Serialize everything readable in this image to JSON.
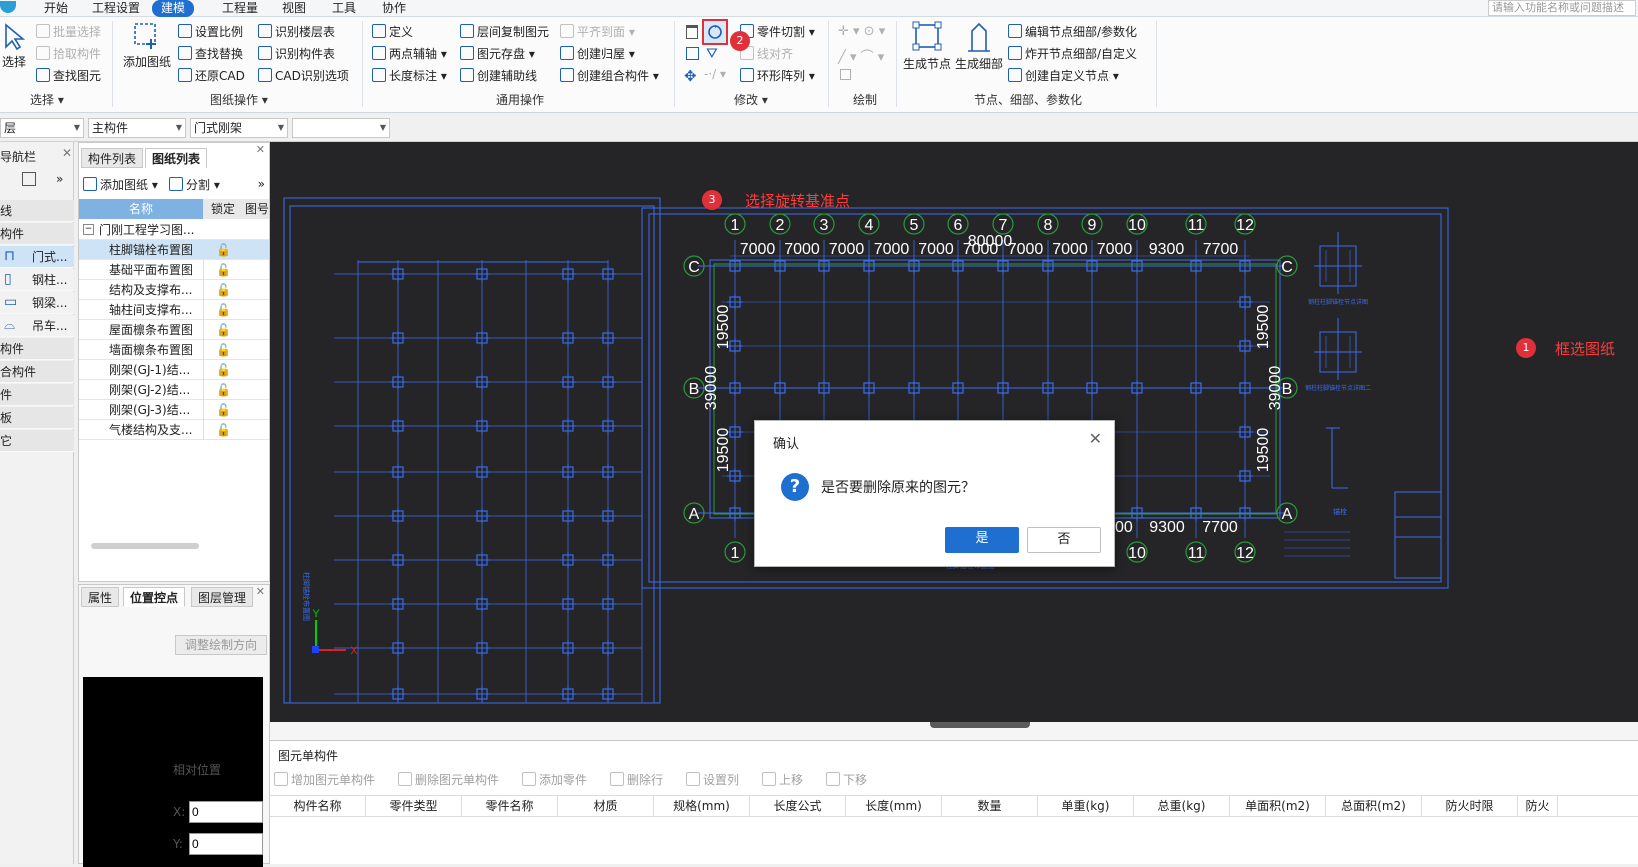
{
  "menubar": {
    "items": [
      "开始",
      "工程设置",
      "建模",
      "工程量",
      "视图",
      "工具",
      "协作"
    ],
    "active_index": 2,
    "search_placeholder": "请输入功能名称或问题描述"
  },
  "ribbon": {
    "select": {
      "big_label": "选择",
      "items": [
        "批量选择",
        "拾取构件",
        "查找图元"
      ],
      "group_label": "选择"
    },
    "drawing_ops": {
      "big_label": "添加图纸",
      "items": [
        "设置比例",
        "查找替换",
        "还原CAD",
        "识别楼层表",
        "识别构件表",
        "CAD识别选项"
      ],
      "group_label": "图纸操作"
    },
    "general_ops": {
      "items": [
        "定义",
        "两点辅轴",
        "长度标注",
        "层间复制图元",
        "图元存盘",
        "创建辅助线",
        "平齐到面",
        "创建归屋",
        "创建组合构件"
      ],
      "group_label": "通用操作"
    },
    "modify": {
      "items": [
        "零件切割",
        "线对齐",
        "环形阵列"
      ],
      "group_label": "修改"
    },
    "draw": {
      "group_label": "绘制"
    },
    "nodes": {
      "big_items": [
        "生成节点",
        "生成细部"
      ],
      "items": [
        "编辑节点细部/参数化",
        "炸开节点细部/自定义",
        "创建自定义节点"
      ],
      "group_label": "节点、细部、参数化"
    }
  },
  "selectors": {
    "floor": "层",
    "category": "主构件",
    "type": "门式刚架",
    "blank": ""
  },
  "nav": {
    "title": "导航栏",
    "rows": [
      "线",
      "构件",
      "门式...",
      "钢柱...",
      "钢梁...",
      "吊车...",
      "构件",
      "合构件",
      "件",
      "板",
      "它"
    ]
  },
  "drawing_panel": {
    "tabs": [
      "构件列表",
      "图纸列表"
    ],
    "toolbar": [
      "添加图纸",
      "分割"
    ],
    "headers": [
      "名称",
      "锁定",
      "图号"
    ],
    "root": "门刚工程学习图...",
    "rows": [
      "柱脚锚栓布置图",
      "基础平面布置图",
      "结构及支撑布...",
      "轴柱间支撑布...",
      "屋面檩条布置图",
      "墙面檩条布置图",
      "刚架(GJ-1)结...",
      "刚架(GJ-2)结...",
      "刚架(GJ-3)结...",
      "气楼结构及支..."
    ],
    "selected_index": 0
  },
  "prop_panel": {
    "tabs": [
      "属性",
      "位置控点",
      "图层管理"
    ],
    "active_tab": 1,
    "adjust_button": "调整绘制方向",
    "relative_label": "相对位置",
    "x_label": "X:",
    "x_value": "0",
    "y_label": "Y:",
    "y_value": "0"
  },
  "canvas": {
    "axes_top": [
      "1",
      "2",
      "3",
      "4",
      "5",
      "6",
      "7",
      "8",
      "9",
      "10",
      "11",
      "12"
    ],
    "spans": [
      "7000",
      "7000",
      "7000",
      "7000",
      "7000",
      "7000",
      "7000",
      "7000",
      "7000",
      "9300",
      "7700"
    ],
    "total": "80000",
    "rows": [
      "C",
      "B",
      "A"
    ],
    "side_dims": [
      "19500",
      "19500"
    ],
    "side_total": "39000",
    "bottom_partial": [
      "00",
      "7000",
      "9300",
      "7700"
    ],
    "tiny_text": {
      "left_plan_caption": "柱脚锚栓布置图",
      "right_caption": "柱脚锚栓布置图",
      "detail_a": "钢柱柱脚锚栓节点详图",
      "detail_b": "钢柱柱脚锚栓节点详图二",
      "detail_c": "锚栓"
    },
    "annotations": [
      {
        "num": "1",
        "text": "框选图纸"
      },
      {
        "num": "2",
        "text": ""
      },
      {
        "num": "3",
        "text": "选择旋转基准点"
      }
    ],
    "axis_x_label": "X",
    "axis_y_label": "Y"
  },
  "dialog": {
    "title": "确认",
    "message": "是否要删除原来的图元？",
    "yes": "是",
    "no": "否",
    "icon": "question-icon"
  },
  "bottom": {
    "title": "图元单构件",
    "toolbar": [
      "增加图元单构件",
      "删除图元单构件",
      "添加零件",
      "删除行",
      "设置列",
      "上移",
      "下移"
    ],
    "columns": [
      "构件名称",
      "零件类型",
      "零件名称",
      "材质",
      "规格(mm)",
      "长度公式",
      "长度(mm)",
      "数量",
      "单重(kg)",
      "总重(kg)",
      "单面积(m2)",
      "总面积(m2)",
      "防火时限",
      "防火"
    ]
  },
  "colors": {
    "accent": "#1e6fd0",
    "canvas_bg": "#252527",
    "cad_blue": "#3a6cf0",
    "badge_red": "#e0303a"
  }
}
